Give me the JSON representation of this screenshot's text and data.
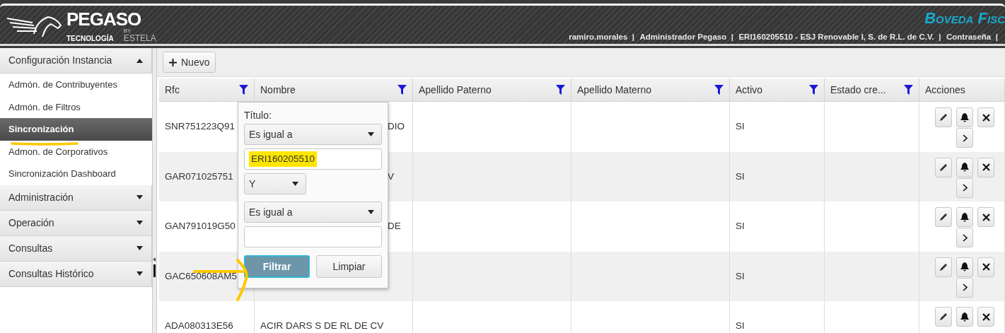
{
  "header": {
    "logo": {
      "brand": "PEGASO",
      "tagline": "TECNOLOGÍA",
      "by": "BY",
      "product": "ESTELA"
    },
    "app_title": "Boveda Fisc",
    "separator": "|",
    "user_links": [
      {
        "text": "ramiro.morales"
      },
      {
        "text": "Administrador Pegaso"
      },
      {
        "text": "ERI160205510 - ESJ Renovable I, S. de R.L. de C.V."
      },
      {
        "text": "Contraseña"
      }
    ]
  },
  "sidebar": {
    "sections": [
      {
        "label": "Configuración Instancia",
        "expanded": true,
        "items": [
          {
            "label": "Admón. de Contribuyentes",
            "selected": false
          },
          {
            "label": "Admón. de Filtros",
            "selected": false
          },
          {
            "label": "Sincronización",
            "selected": true
          },
          {
            "label": "Admon. de Corporativos",
            "selected": false
          },
          {
            "label": "Sincronización Dashboard",
            "selected": false
          }
        ]
      },
      {
        "label": "Administración",
        "expanded": false
      },
      {
        "label": "Operación",
        "expanded": false
      },
      {
        "label": "Consultas",
        "expanded": false
      },
      {
        "label": "Consultas Histórico",
        "expanded": false
      }
    ]
  },
  "toolbar": {
    "new_button": {
      "label": "Nuevo"
    }
  },
  "table": {
    "columns": [
      {
        "label": "Rfc",
        "filterable": true
      },
      {
        "label": "Nombre",
        "filterable": true
      },
      {
        "label": "Apellido Paterno",
        "filterable": true
      },
      {
        "label": "Apellido Materno",
        "filterable": true
      },
      {
        "label": "Activo",
        "filterable": true
      },
      {
        "label": "Estado cre...",
        "filterable": true
      },
      {
        "label": "Acciones",
        "filterable": false
      }
    ],
    "rows": [
      {
        "cells": [
          "SNR751223Q91",
          "DIO",
          null,
          null,
          "SI",
          null
        ],
        "actions": [
          {
            "kind": "edit"
          },
          {
            "kind": "bell"
          },
          {
            "kind": "close"
          },
          {
            "kind": "next"
          }
        ]
      },
      {
        "cells": [
          "GAR071025751",
          "V",
          null,
          null,
          "SI",
          null
        ],
        "actions": [
          {
            "kind": "edit"
          },
          {
            "kind": "bell"
          },
          {
            "kind": "close"
          },
          {
            "kind": "next"
          }
        ]
      },
      {
        "cells": [
          "GAN791019G50",
          "DE",
          null,
          null,
          "SI",
          null
        ],
        "actions": [
          {
            "kind": "edit"
          },
          {
            "kind": "bell"
          },
          {
            "kind": "close"
          },
          {
            "kind": "next"
          }
        ]
      },
      {
        "cells": [
          "GAC650608AM5",
          null,
          null,
          null,
          "SI",
          null
        ],
        "actions": [
          {
            "kind": "edit"
          },
          {
            "kind": "bell"
          },
          {
            "kind": "close"
          },
          {
            "kind": "next"
          }
        ]
      },
      {
        "cells": [
          "ADA080313E56",
          "ACIR DARS S DE RL DE CV",
          null,
          null,
          "SI",
          null
        ],
        "actions": [
          {
            "kind": "edit"
          },
          {
            "kind": "bell"
          },
          {
            "kind": "close"
          }
        ]
      }
    ]
  },
  "filter_popup": {
    "label": "Título:",
    "fields": [
      {
        "kind": "select",
        "value": "Es igual a"
      },
      {
        "kind": "input",
        "value": "ERI160205510",
        "highlighted": true
      },
      {
        "kind": "operator",
        "value": "Y"
      },
      {
        "kind": "select",
        "value": "Es igual a"
      },
      {
        "kind": "input"
      }
    ],
    "buttons": [
      {
        "label": "Filtrar",
        "primary": true
      },
      {
        "label": "Limpiar",
        "primary": false
      }
    ]
  },
  "annotations": {
    "underline": {
      "color": "#ffc800"
    },
    "arrow": {
      "color": "#ffc800"
    }
  }
}
